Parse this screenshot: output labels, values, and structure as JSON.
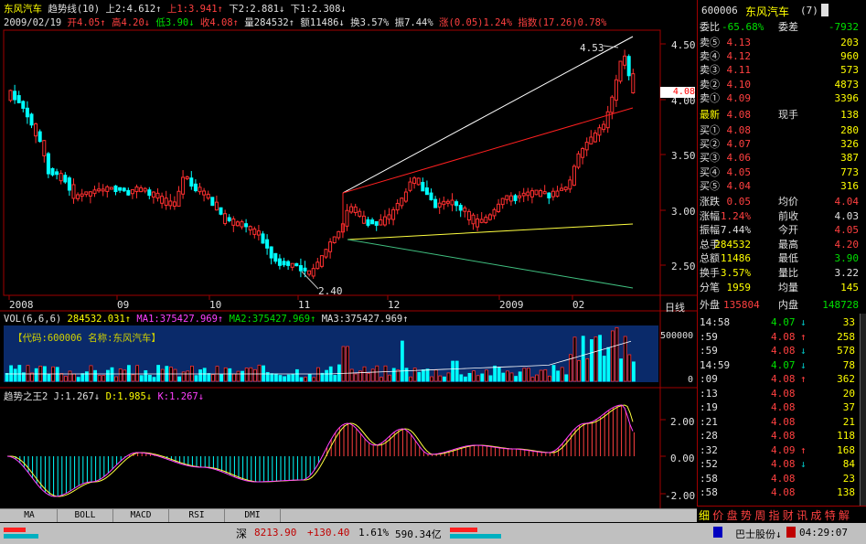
{
  "header": {
    "stock_name": "东风汽车",
    "indicator": "趋势线(10)",
    "line_values": [
      "上2:4.612↑",
      "上1:3.941↑",
      "下2:2.881↓",
      "下1:2.308↓"
    ],
    "date": "2009/02/19",
    "open": "开4.05↑",
    "high": "高4.20↓",
    "low": "低3.90↓",
    "close": "收4.08↑",
    "volume": "量284532↑",
    "amount": "额11486↓",
    "turnover": "换3.57%",
    "amplitude": "振7.44%",
    "change": "涨(0.05)1.24%",
    "index": "指数(17.26)0.78%"
  },
  "price_chart": {
    "y_ticks": [
      "4.50",
      "4.00",
      "3.50",
      "3.00",
      "2.50"
    ],
    "current_price_tag": "4.08",
    "high_annotation": "4.53",
    "low_annotation": "2.40",
    "x_labels": [
      "2008",
      "09",
      "10",
      "11",
      "12",
      "2009",
      "02"
    ],
    "x_axis_unit": "日线",
    "colors": {
      "up": "#ff3030",
      "down": "#00ffff",
      "upper_line": "#ffffff",
      "mid_line": "#ff2020",
      "support_line": "#ffff40",
      "lower_line": "#40c080"
    }
  },
  "volume_panel": {
    "title": "VOL(6,6,6)",
    "value": "284532.031↑",
    "ma1": "MA1:375427.969↑",
    "ma2": "MA2:375427.969↑",
    "ma3": "MA3:375427.969↑",
    "info": "【代码:600006 名称:东风汽车】",
    "y_ticks": [
      "500000",
      "0"
    ]
  },
  "trend_panel": {
    "title": "趋势之王2",
    "j": "J:1.267↓",
    "d": "D:1.985↓",
    "k": "K:1.267↓",
    "y_ticks": [
      "2.00",
      "0.00",
      "-2.00"
    ]
  },
  "tabs": [
    "MA",
    "BOLL",
    "MACD",
    "RSI",
    "DMI"
  ],
  "side": {
    "code": "600006",
    "name": "东风汽车",
    "badge": "(7)",
    "weibi_label": "委比",
    "weibi_value": "-65.68%",
    "weicha_label": "委差",
    "weicha_value": "-7932",
    "sells": [
      {
        "label": "卖⑤",
        "price": "4.13",
        "vol": "203"
      },
      {
        "label": "卖④",
        "price": "4.12",
        "vol": "960"
      },
      {
        "label": "卖③",
        "price": "4.11",
        "vol": "573"
      },
      {
        "label": "卖②",
        "price": "4.10",
        "vol": "4873"
      },
      {
        "label": "卖①",
        "price": "4.09",
        "vol": "3396"
      }
    ],
    "latest_label": "最新",
    "latest_value": "4.08",
    "xianshou_label": "现手",
    "xianshou_value": "138",
    "buys": [
      {
        "label": "买①",
        "price": "4.08",
        "vol": "280"
      },
      {
        "label": "买②",
        "price": "4.07",
        "vol": "326"
      },
      {
        "label": "买③",
        "price": "4.06",
        "vol": "387"
      },
      {
        "label": "买④",
        "price": "4.05",
        "vol": "773"
      },
      {
        "label": "买⑤",
        "price": "4.04",
        "vol": "316"
      }
    ],
    "stats": [
      [
        "涨跌",
        "0.05",
        "均价",
        "4.04"
      ],
      [
        "涨幅",
        "1.24%",
        "前收",
        "4.03"
      ],
      [
        "振幅",
        "7.44%",
        "今开",
        "4.05"
      ],
      [
        "总手",
        "284532",
        "最高",
        "4.20"
      ],
      [
        "总额",
        "11486",
        "最低",
        "3.90"
      ],
      [
        "换手",
        "3.57%",
        "量比",
        "3.22"
      ],
      [
        "分笔",
        "1959",
        "均量",
        "145"
      ]
    ],
    "outer_label": "外盘",
    "outer_value": "135804",
    "inner_label": "内盘",
    "inner_value": "148728",
    "ticks": [
      {
        "time": "14:58",
        "price": "4.07",
        "dir": "↓",
        "vol": "33"
      },
      {
        "time": ":59",
        "price": "4.08",
        "dir": "↑",
        "vol": "258"
      },
      {
        "time": ":59",
        "price": "4.08",
        "dir": "↓",
        "vol": "578"
      },
      {
        "time": "14:59",
        "price": "4.07",
        "dir": "↓",
        "vol": "78"
      },
      {
        "time": ":09",
        "price": "4.08",
        "dir": "↑",
        "vol": "362"
      },
      {
        "time": ":13",
        "price": "4.08",
        "dir": "",
        "vol": "20"
      },
      {
        "time": ":19",
        "price": "4.08",
        "dir": "",
        "vol": "37"
      },
      {
        "time": ":21",
        "price": "4.08",
        "dir": "",
        "vol": "21"
      },
      {
        "time": ":28",
        "price": "4.08",
        "dir": "",
        "vol": "118"
      },
      {
        "time": ":32",
        "price": "4.09",
        "dir": "↑",
        "vol": "168"
      },
      {
        "time": ":52",
        "price": "4.08",
        "dir": "↓",
        "vol": "84"
      },
      {
        "time": ":58",
        "price": "4.08",
        "dir": "",
        "vol": "23"
      },
      {
        "time": ":58",
        "price": "4.08",
        "dir": "",
        "vol": "138"
      }
    ],
    "bottom_tabs": [
      "细",
      "价",
      "盘",
      "势",
      "周",
      "指",
      "财",
      "讯",
      "成",
      "特",
      "解"
    ]
  },
  "status": {
    "market": "深",
    "index_value": "8213.90",
    "index_change": "+130.40",
    "index_pct": "1.61%",
    "turnover": "590.34亿",
    "stock_alert": "巴士股份↓",
    "time": "04:29:07"
  }
}
